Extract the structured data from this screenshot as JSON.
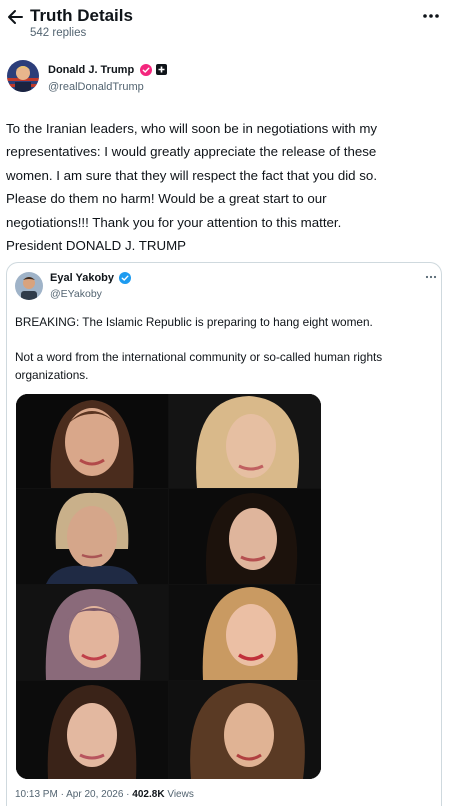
{
  "header": {
    "title": "Truth Details",
    "replies": "542 replies"
  },
  "author": {
    "name": "Donald J. Trump",
    "handle": "@realDonaldTrump"
  },
  "post": {
    "lines": [
      "To the Iranian leaders, who will soon be in negotiations with my",
      "representatives: I would greatly appreciate the release of these",
      "women. I am sure that they will respect the fact that you did so.",
      "Please do them no harm! Would be a great start to our",
      "negotiations!!! Thank you for your attention to this matter.",
      "President DONALD J. TRUMP"
    ]
  },
  "quote": {
    "name": "Eyal Yakoby",
    "handle": "@EYakoby",
    "text1": "BREAKING: The Islamic Republic is preparing to hang eight women.",
    "text2": "Not a word from the international community or so-called human rights organizations.",
    "time": "10:13 PM · Apr 20, 2026 · ",
    "views_count": "402.8K",
    "views_label": " Views"
  },
  "colors": {
    "accent_pink": "#f4267d",
    "verified_blue": "#1d9bf0",
    "text_secondary": "#536471"
  },
  "icons": [
    "back-arrow-icon",
    "more-horizontal-icon",
    "verified-badge-icon",
    "plus-badge-icon"
  ]
}
